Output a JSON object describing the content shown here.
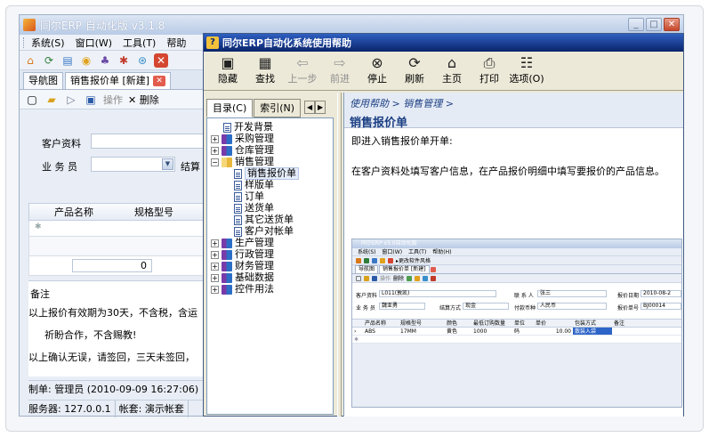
{
  "erp": {
    "title": "同尔ERP 自动化版 v3.1.8",
    "menu": [
      "系统(S)",
      "窗口(W)",
      "工具(T)",
      "帮助"
    ],
    "tabs": [
      "导航图",
      "销售报价单 [新建]"
    ],
    "subtoolbar": {
      "ops": "操作",
      "delete": "删除"
    },
    "form": {
      "customer_label": "客户资料",
      "salesman_label": "业 务 员",
      "settle_label": "结算"
    },
    "grid": {
      "headers": [
        "产品名称",
        "规格型号"
      ],
      "total_value": "0"
    },
    "notes": {
      "label": "备注",
      "line1": "以上报价有效期为30天，不含税，含运",
      "line2": "祈盼合作，不含赐教!",
      "line3": "以上确认无误，请签回，三天未签回，"
    },
    "status_maker": "制单: 管理员 (2010-09-09 16:27:06)",
    "status_server": "服务器: 127.0.0.1",
    "status_account": "帐套: 演示帐套"
  },
  "help": {
    "title": "同尔ERP自动化系统使用帮助",
    "toolbar": [
      {
        "label": "隐藏",
        "icon": "hide-icon",
        "glyph": "▣",
        "enabled": true
      },
      {
        "label": "查找",
        "icon": "find-icon",
        "glyph": "▦",
        "enabled": true
      },
      {
        "label": "上一步",
        "icon": "back-icon",
        "glyph": "⇦",
        "enabled": false
      },
      {
        "label": "前进",
        "icon": "forward-icon",
        "glyph": "⇨",
        "enabled": false
      },
      {
        "label": "停止",
        "icon": "stop-icon",
        "glyph": "⊗",
        "enabled": true
      },
      {
        "label": "刷新",
        "icon": "refresh-icon",
        "glyph": "⟳",
        "enabled": true
      },
      {
        "label": "主页",
        "icon": "home-icon",
        "glyph": "⌂",
        "enabled": true
      },
      {
        "label": "打印",
        "icon": "print-icon",
        "glyph": "⎙",
        "enabled": true
      },
      {
        "label": "选项(O)",
        "icon": "options-icon",
        "glyph": "☷",
        "enabled": true
      }
    ],
    "nav_tabs": [
      "目录(C)",
      "索引(N)"
    ],
    "tree": {
      "background": "开发背景",
      "purchase": "采购管理",
      "warehouse": "仓库管理",
      "sales": "销售管理",
      "sales_children": [
        "销售报价单",
        "样版单",
        "订单",
        "送货单",
        "其它送货单",
        "客户对帐单"
      ],
      "production": "生产管理",
      "admin": "行政管理",
      "finance": "财务管理",
      "basic": "基础数据",
      "controls": "控件用法"
    },
    "content": {
      "breadcrumb": "使用帮助 > 销售管理 >",
      "title": "销售报价单",
      "para1": "即进入销售报价单开单:",
      "para2": "在客户资料处填写客户信息，在产品报价明细中填写要报价的产品信息。"
    },
    "shot": {
      "title": "同尔ERP v3.0自动化版",
      "menu": [
        "系统(S)",
        "窗口(W)",
        "工具(T)",
        "帮助(H)"
      ],
      "switch_label": "更改软件风格",
      "tabs": [
        "导航图",
        "销售报价单 [新建]"
      ],
      "ops": "操作",
      "delete": "删除",
      "customer_label": "客户资料",
      "customer_value": "L011(敦凯)",
      "contact_label": "联 系 人",
      "contact_value": "张三",
      "date_label": "报价日期",
      "date_value": "2010-08-2",
      "salesman_label": "业 务 员",
      "salesman_value": "魏亚勇",
      "settle_label": "结算方式",
      "settle_value": "现金",
      "currency_label": "付款币种",
      "currency_value": "人民币",
      "no_label": "报价单号",
      "no_value": "BJ00014",
      "grid_headers": [
        "产品名称",
        "规格型号",
        "颜色",
        "最低订购数量",
        "单位",
        "单价",
        "包装方式",
        "备注"
      ],
      "row": [
        "ABS",
        "17MM",
        "黄色",
        "1000",
        "码",
        "10.00",
        "散装入袋",
        ""
      ]
    }
  },
  "colors": {
    "help_title_start": "#2f5fc2",
    "help_title_end": "#0a246a",
    "content_link": "#1b3f83"
  }
}
